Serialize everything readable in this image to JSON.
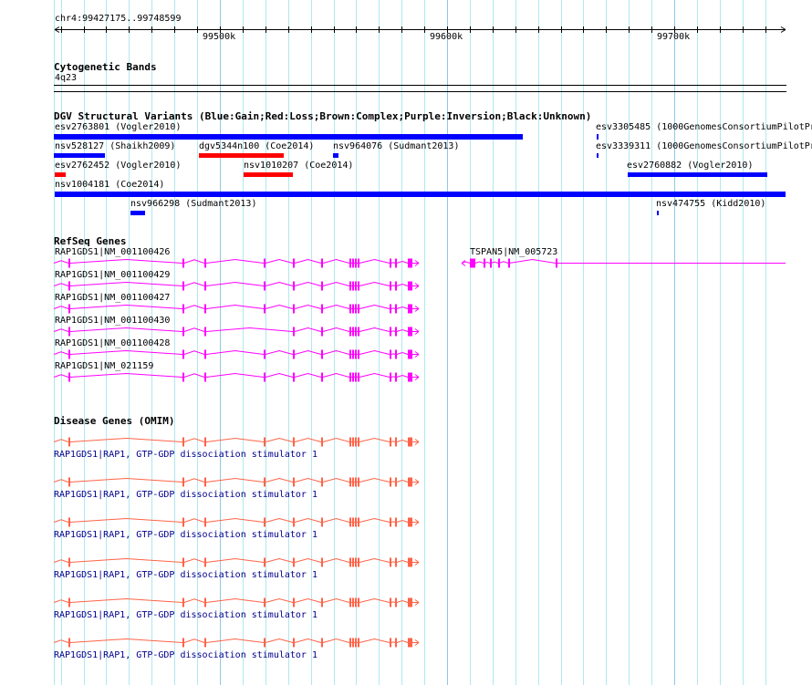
{
  "region": "chr4:99427175..99748599",
  "ruler": {
    "major_labels": [
      "99500k",
      "99600k",
      "99700k"
    ]
  },
  "tracks": {
    "cytoband": {
      "title": "Cytogenetic Bands",
      "band": "4q23"
    },
    "dgv": {
      "title": "DGV Structural Variants (Blue:Gain;Red:Loss;Brown:Complex;Purple:Inversion;Black:Unknown)",
      "features": [
        {
          "label": "esv2763801 (Vogler2010)",
          "type": "gain"
        },
        {
          "label": "esv3305485 (1000GenomesConsortiumPilotPr",
          "type": "gain"
        },
        {
          "label": "nsv528127 (Shaikh2009)",
          "type": "gain"
        },
        {
          "label": "dgv5344n100 (Coe2014)",
          "type": "loss"
        },
        {
          "label": "nsv964076 (Sudmant2013)",
          "type": "gain"
        },
        {
          "label": "esv3339311 (1000GenomesConsortiumPilotPr",
          "type": "gain"
        },
        {
          "label": "esv2762452 (Vogler2010)",
          "type": "loss"
        },
        {
          "label": "nsv1010207 (Coe2014)",
          "type": "loss"
        },
        {
          "label": "esv2760882 (Vogler2010)",
          "type": "gain"
        },
        {
          "label": "nsv1004181 (Coe2014)",
          "type": "gain"
        },
        {
          "label": "nsv966298 (Sudmant2013)",
          "type": "gain"
        },
        {
          "label": "nsv474755 (Kidd2010)",
          "type": "gain"
        }
      ]
    },
    "refseq": {
      "title": "RefSeq Genes",
      "genes": [
        {
          "label": "RAP1GDS1|NM_001100426"
        },
        {
          "label": "RAP1GDS1|NM_001100429"
        },
        {
          "label": "RAP1GDS1|NM_001100427"
        },
        {
          "label": "RAP1GDS1|NM_001100430"
        },
        {
          "label": "RAP1GDS1|NM_001100428"
        },
        {
          "label": "RAP1GDS1|NM_021159"
        },
        {
          "label": "TSPAN5|NM_005723"
        }
      ]
    },
    "omim": {
      "title": "Disease Genes (OMIM)",
      "genes": [
        {
          "label": "RAP1GDS1|RAP1, GTP-GDP dissociation stimulator 1"
        },
        {
          "label": "RAP1GDS1|RAP1, GTP-GDP dissociation stimulator 1"
        },
        {
          "label": "RAP1GDS1|RAP1, GTP-GDP dissociation stimulator 1"
        },
        {
          "label": "RAP1GDS1|RAP1, GTP-GDP dissociation stimulator 1"
        },
        {
          "label": "RAP1GDS1|RAP1, GTP-GDP dissociation stimulator 1"
        },
        {
          "label": "RAP1GDS1|RAP1, GTP-GDP dissociation stimulator 1"
        }
      ]
    }
  },
  "colors": {
    "gain": "#0000ff",
    "loss": "#ff0000",
    "refseq": "#ff00ff",
    "omim": "#ff6347",
    "grid": "#aee9f0",
    "grid_major": "#8fc8e8",
    "omim_label": "#00008b"
  }
}
